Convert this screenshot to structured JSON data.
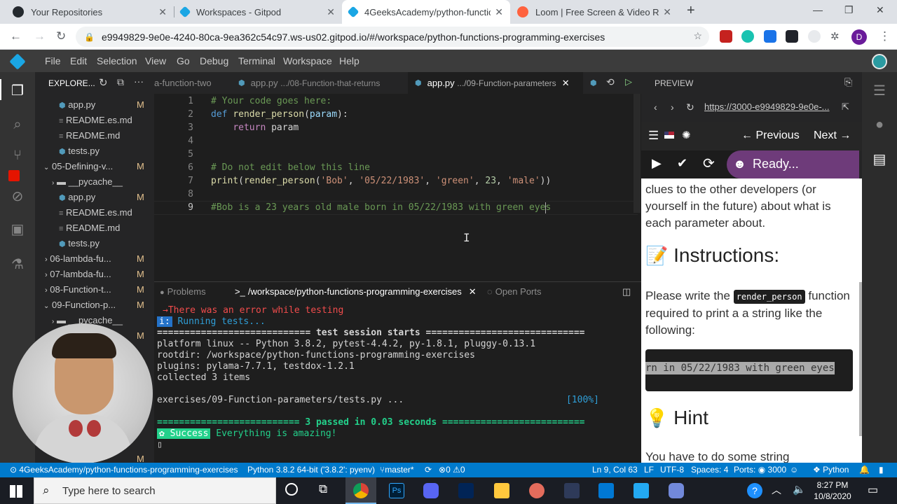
{
  "browser": {
    "tabs": [
      {
        "title": "Your Repositories",
        "icon": "github-icon"
      },
      {
        "title": "Workspaces - Gitpod",
        "icon": "gitpod-icon"
      },
      {
        "title": "4GeeksAcademy/python-functio",
        "icon": "gitpod-icon"
      },
      {
        "title": "Loom | Free Screen & Video Rec",
        "icon": "loom-icon"
      }
    ],
    "close_glyph": "✕",
    "new_tab_glyph": "+",
    "url": "e9949829-9e0e-4240-80ca-9ea362c54c97.ws-us02.gitpod.io/#/workspace/python-functions-programming-exercises",
    "profile_initial": "D"
  },
  "menubar": {
    "items": [
      "File",
      "Edit",
      "Selection",
      "View",
      "Go",
      "Debug",
      "Terminal",
      "Workspace",
      "Help"
    ]
  },
  "explorer": {
    "title": "EXPLORE...",
    "items": [
      {
        "label": "app.py",
        "flag": "M"
      },
      {
        "label": "README.es.md",
        "flag": ""
      },
      {
        "label": "README.md",
        "flag": ""
      },
      {
        "label": "tests.py",
        "flag": ""
      },
      {
        "label": "05-Defining-v...",
        "flag": "M"
      },
      {
        "label": "__pycache__",
        "flag": ""
      },
      {
        "label": "app.py",
        "flag": "M"
      },
      {
        "label": "README.es.md",
        "flag": ""
      },
      {
        "label": "README.md",
        "flag": ""
      },
      {
        "label": "tests.py",
        "flag": ""
      },
      {
        "label": "06-lambda-fu...",
        "flag": "M"
      },
      {
        "label": "07-lambda-fu...",
        "flag": "M"
      },
      {
        "label": "08-Function-t...",
        "flag": "M"
      },
      {
        "label": "09-Function-p...",
        "flag": "M"
      },
      {
        "label": "__pycache__",
        "flag": ""
      },
      {
        "label": "",
        "flag": "M"
      }
    ]
  },
  "editor": {
    "tabs": [
      {
        "label": "a-function-two"
      },
      {
        "label": "app.py",
        "path": ".../08-Function-that-returns"
      },
      {
        "label": "app.py",
        "path": ".../09-Function-parameters",
        "close": "✕"
      }
    ],
    "lines": [
      {
        "n": "1",
        "text": "# Your code goes here:"
      },
      {
        "n": "2",
        "text": "def render_person(param):"
      },
      {
        "n": "3",
        "text": "    return param"
      },
      {
        "n": "4",
        "text": ""
      },
      {
        "n": "5",
        "text": ""
      },
      {
        "n": "6",
        "text": "# Do not edit below this line"
      },
      {
        "n": "7",
        "text": "print(render_person('Bob', '05/22/1983', 'green', 23, 'male'))"
      },
      {
        "n": "8",
        "text": ""
      },
      {
        "n": "9",
        "text": "#Bob is a 23 years old male born in 05/22/1983 with green eyes"
      }
    ]
  },
  "panel": {
    "tabs": [
      "Problems",
      "/workspace/python-functions-programming-exercises",
      "Open Ports"
    ],
    "terminal": [
      "→There was an error while testing",
      "Running tests...",
      "============================ test session starts =============================",
      "platform linux -- Python 3.8.2, pytest-4.4.2, py-1.8.1, pluggy-0.13.1",
      "rootdir: /workspace/python-functions-programming-exercises",
      "plugins: pylama-7.7.1, testdox-1.2.1",
      "collected 3 items",
      "",
      "exercises/09-Function-parameters/tests.py ...",
      "",
      "========================== 3 passed in 0.03 seconds ==========================",
      "Everything is amazing!"
    ],
    "info_badge": "i:",
    "percent": "[100%]",
    "success_badge": "✿ Success"
  },
  "preview": {
    "title": "PREVIEW",
    "url": "https://3000-e9949829-9e0e-...",
    "previous": "← Previous",
    "next": "Next →",
    "ready": "Ready...",
    "intro_text": "clues to the other developers (or yourself in the future) about what is each parameter about.",
    "instructions_heading": "Instructions:",
    "instructions_before": "Please write the",
    "code_inline": "render_person",
    "instructions_after": "function required to print a a string like the following:",
    "code_block": "rn in 05/22/1983 with green eyes",
    "hint_heading": "Hint",
    "hint_text": "You have to do some string"
  },
  "statusbar": {
    "branch_repo": "4GeeksAcademy/python-functions-programming-exercises",
    "python": "Python 3.8.2 64-bit ('3.8.2': pyenv)",
    "git_branch": "master*",
    "errors": "0",
    "warnings": "0",
    "cursor": "Ln 9, Col 63",
    "eol": "LF",
    "encoding": "UTF-8",
    "spaces": "Spaces: 4",
    "ports": "Ports:",
    "port": "3000",
    "language": "Python"
  },
  "taskbar": {
    "search_placeholder": "Type here to search",
    "time": "8:27 PM",
    "date": "10/8/2020"
  },
  "colors": {
    "vscode_blue": "#007acc",
    "error_red": "#f14c4c",
    "success_green": "#23d18b",
    "comment_green": "#6a9955"
  }
}
